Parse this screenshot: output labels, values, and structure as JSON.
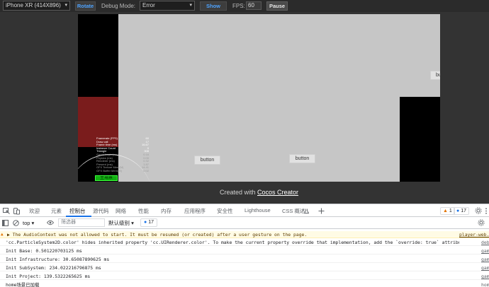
{
  "toolbar": {
    "device": "iPhone XR (414X896)",
    "rotate": "Rotate",
    "debug_mode_label": "Debug Mode:",
    "debug_mode_value": "Error",
    "show_fps": "Show FPS",
    "fps_label": "FPS:",
    "fps_value": "60",
    "pause": "Pause"
  },
  "game": {
    "stats": [
      {
        "label": "Framerate (FPS)",
        "value": "60"
      },
      {
        "label": "Draw call",
        "value": "17"
      },
      {
        "label": "Frame time (ms)",
        "value": "16.67"
      },
      {
        "label": "Instance Count",
        "value": "0"
      },
      {
        "label": "Triangle",
        "value": "308"
      },
      {
        "label": "Game Logic (ms)",
        "value": "0.16"
      },
      {
        "label": "Physics (ms)",
        "value": "0.00"
      },
      {
        "label": "Renderer (ms)",
        "value": "0.32"
      },
      {
        "label": "Present (ms)",
        "value": "1.87"
      },
      {
        "label": "GFX Texture Mem(M)",
        "value": "14.41"
      },
      {
        "label": "GFX Buffer Mem(M)",
        "value": "0.02"
      }
    ],
    "green_label": "主場景",
    "button1": "button",
    "button2": "button",
    "button3": "bu"
  },
  "credit": {
    "prefix": "Created with ",
    "link": "Cocos Creator"
  },
  "devtools": {
    "tabs": [
      "欢迎",
      "元素",
      "控制台",
      "源代码",
      "网络",
      "性能",
      "内存",
      "应用程序",
      "安全性",
      "Lighthouse",
      "CSS 概述"
    ],
    "warnings_count": "1",
    "messages_count": "17",
    "context": "top",
    "filter_placeholder": "筛选器",
    "level": "默认级别",
    "issues_count": "17"
  },
  "console": [
    {
      "type": "warn",
      "text": "The AudioContext was not allowed to start. It must be resumed (or created) after a user gesture on the page.",
      "source": "player-web.js"
    },
    {
      "type": "log",
      "text": "'cc.ParticleSystem2D.color' hides inherited property 'cc.UIRenderer.color'. To make the current property override that implementation, add the `override: true` attribute please.",
      "source": "debug.ts"
    },
    {
      "type": "log",
      "text": "Init Base: 0.501220703125 ms",
      "source": "game.ts"
    },
    {
      "type": "log",
      "text": "Init Infrastructure: 30.65087890625 ms",
      "source": "game.ts"
    },
    {
      "type": "log",
      "text": "Init SubSystem: 234.022216796875 ms",
      "source": "game.ts"
    },
    {
      "type": "log",
      "text": "Init Project: 139.5322265625 ms",
      "source": "game.ts"
    },
    {
      "type": "log",
      "text": "home场景已加载",
      "source": "home.ts"
    }
  ],
  "colors": {
    "accent": "#1a73e8",
    "warning": "#e37400",
    "cocos_link": "#4ea3ff"
  }
}
